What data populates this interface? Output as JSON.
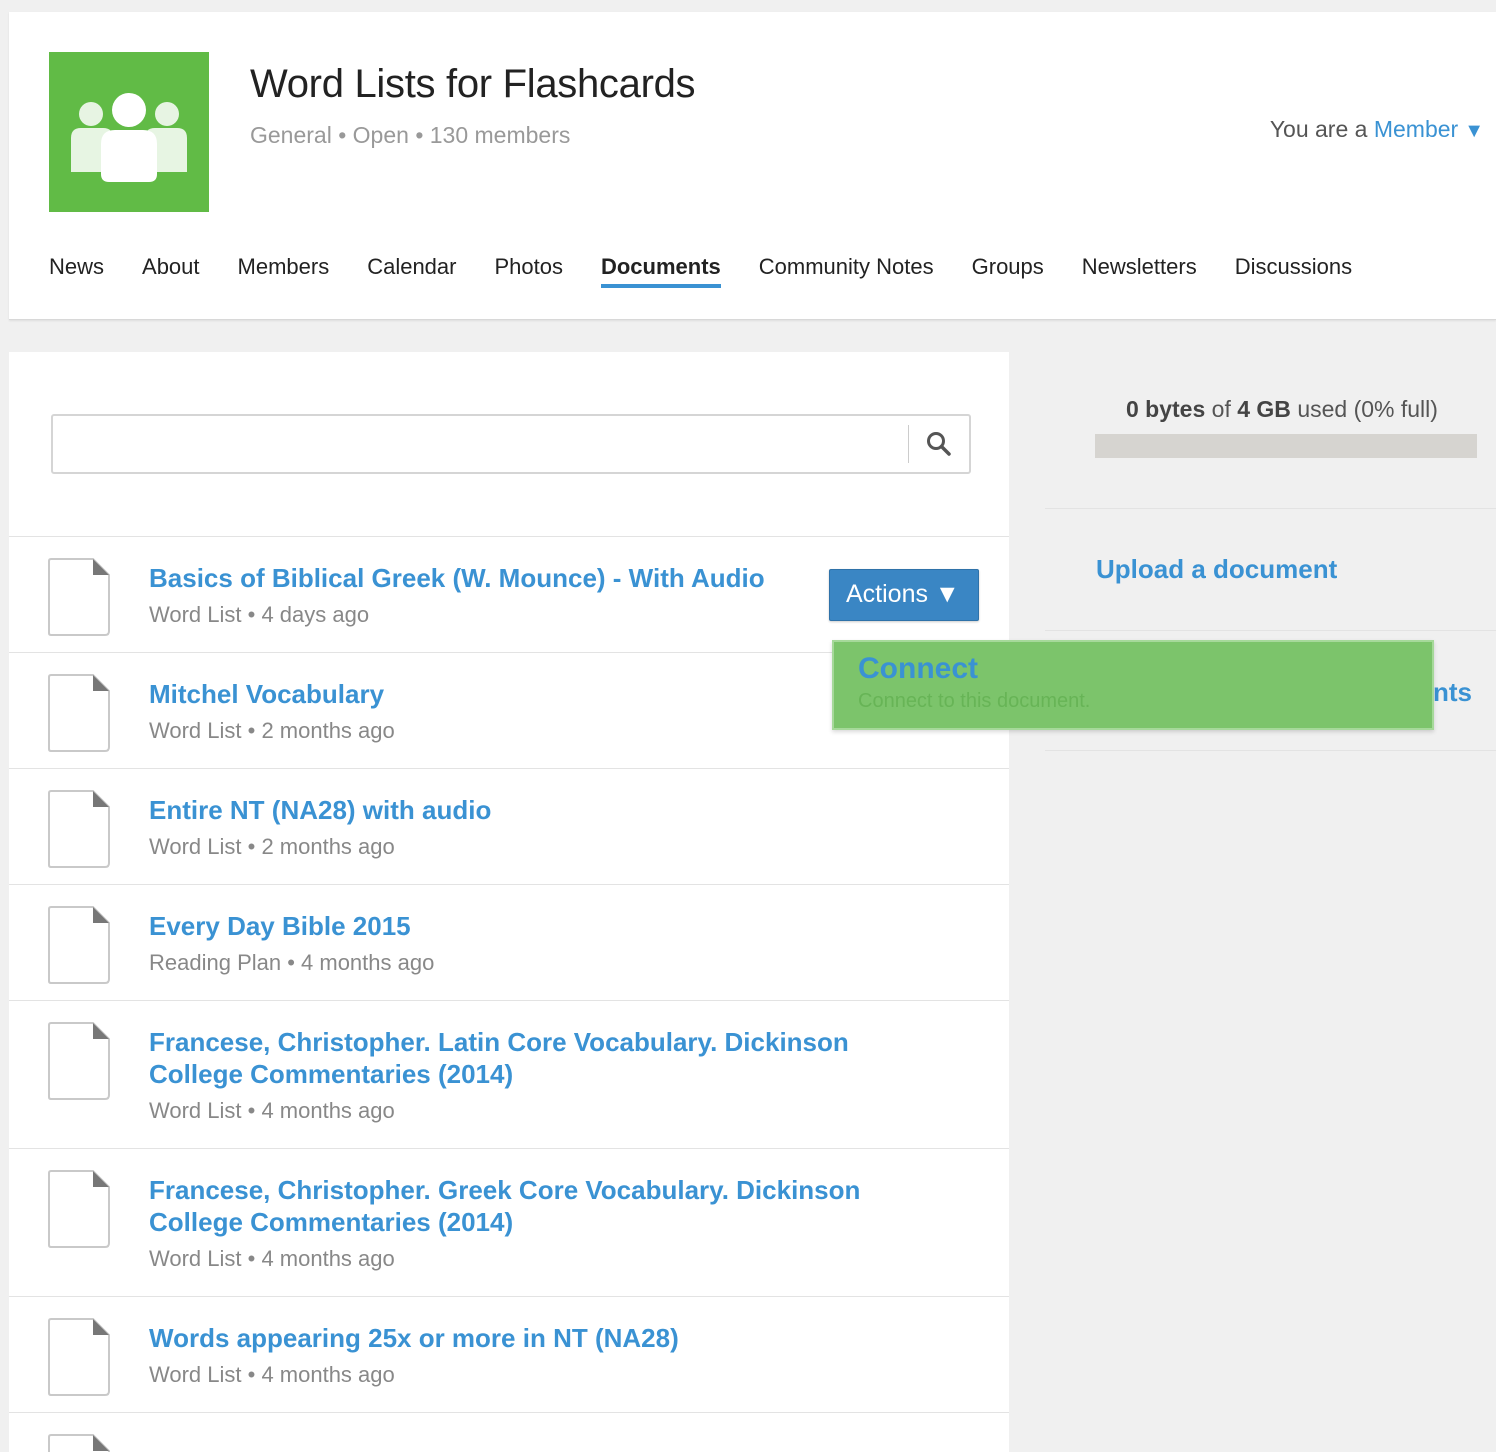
{
  "group": {
    "title": "Word Lists for Flashcards",
    "meta": "General • Open • 130 members",
    "logo_icon": "group-people-icon",
    "logo_color": "#61bb46"
  },
  "membership": {
    "prefix": "You are a",
    "role": "Member",
    "caret": "▼"
  },
  "tabs": [
    {
      "label": "News"
    },
    {
      "label": "About"
    },
    {
      "label": "Members"
    },
    {
      "label": "Calendar"
    },
    {
      "label": "Photos"
    },
    {
      "label": "Documents",
      "active": true
    },
    {
      "label": "Community Notes"
    },
    {
      "label": "Groups"
    },
    {
      "label": "Newsletters"
    },
    {
      "label": "Discussions"
    }
  ],
  "search": {
    "value": "",
    "placeholder": "",
    "icon": "search-icon"
  },
  "documents": [
    {
      "title": "Basics of Biblical Greek (W. Mounce) - With Audio",
      "meta": "Word List • 4 days ago"
    },
    {
      "title": "Mitchel Vocabulary",
      "meta": "Word List • 2 months ago"
    },
    {
      "title": "Entire NT (NA28) with audio",
      "meta": "Word List • 2 months ago"
    },
    {
      "title": "Every Day Bible 2015",
      "meta": "Reading Plan • 4 months ago"
    },
    {
      "title": "Francese, Christopher. Latin Core Vocabulary. Dickinson College Commentaries (2014)",
      "meta": "Word List • 4 months ago"
    },
    {
      "title": "Francese, Christopher. Greek Core Vocabulary. Dickinson College Commentaries (2014)",
      "meta": "Word List • 4 months ago"
    },
    {
      "title": "Words appearing 25x or more in NT (NA28)",
      "meta": "Word List • 4 months ago"
    }
  ],
  "actions": {
    "label": "Actions ▼"
  },
  "dropdown": {
    "title": "Connect",
    "description": "Connect to this document."
  },
  "storage": {
    "used": "0 bytes",
    "of": "of",
    "total": "4 GB",
    "suffix": "used (0% full)",
    "fill_fraction": 0
  },
  "sidebar": {
    "upload_label": "Upload a document",
    "obscured_label_fragment": "nts"
  },
  "colors": {
    "accent": "#3a92d3",
    "brand_green": "#61bb46",
    "actions_button": "#3a86c4",
    "dropdown_bg": "#7cc46b"
  }
}
